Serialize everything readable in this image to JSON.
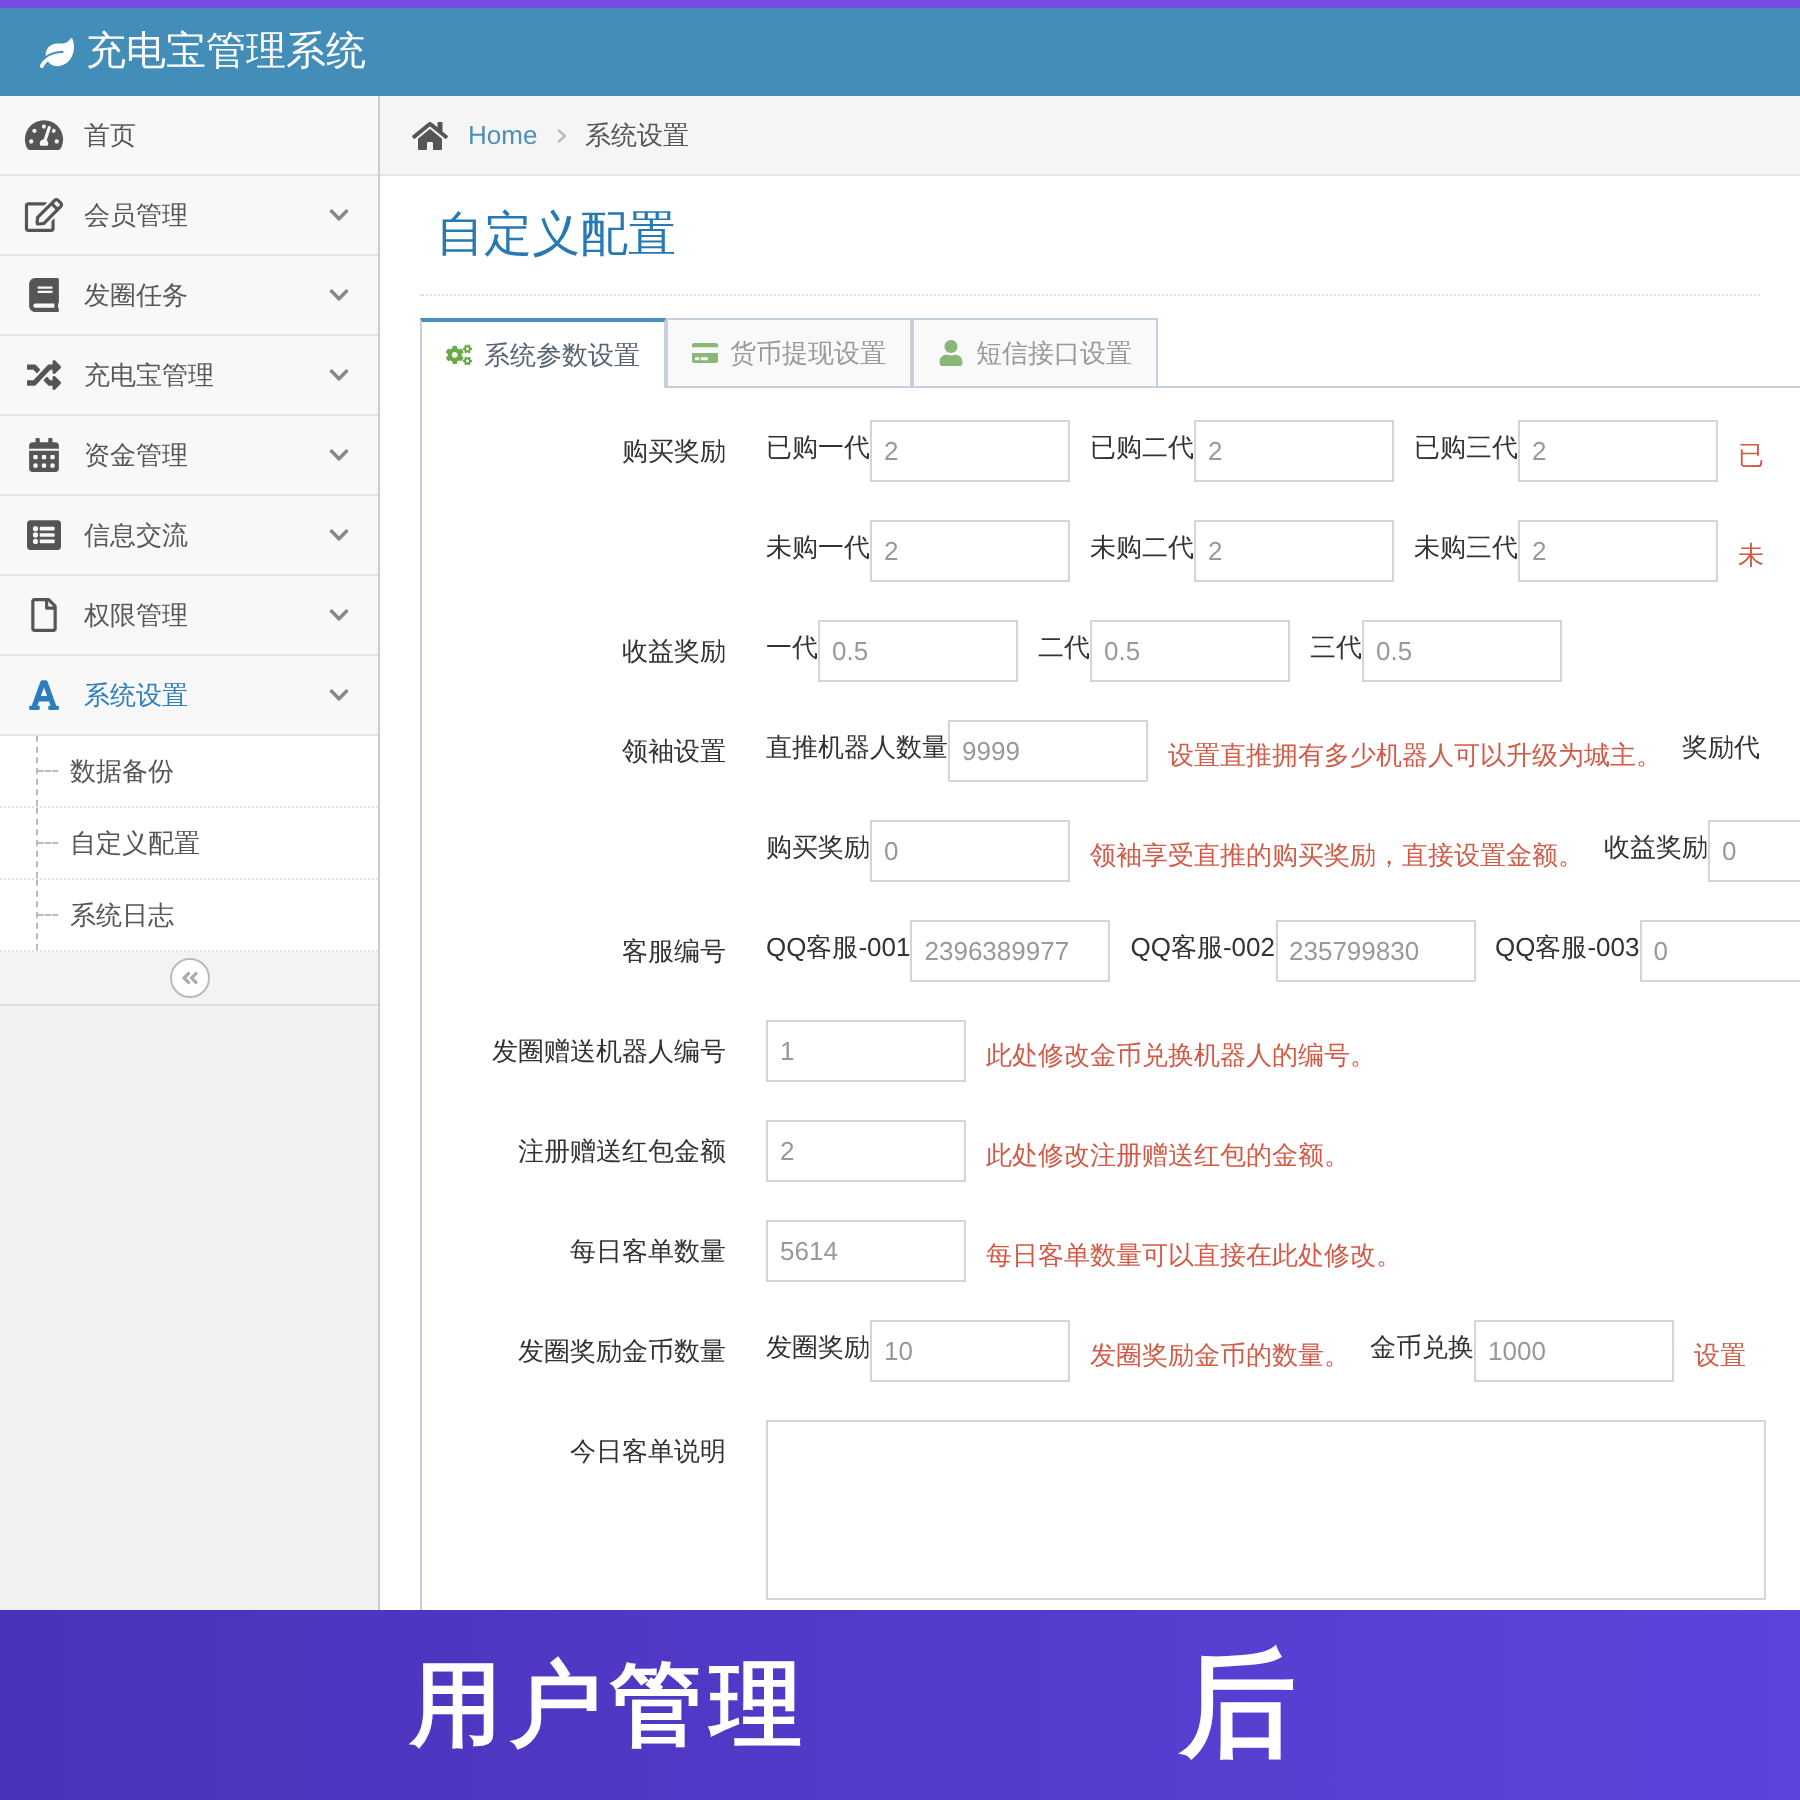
{
  "header": {
    "title": "充电宝管理系统"
  },
  "sidebar": {
    "items": [
      {
        "kind": "link",
        "label": "首页",
        "selected": false
      },
      {
        "kind": "menu",
        "label": "会员管理",
        "selected": false
      },
      {
        "kind": "menu",
        "label": "发圈任务",
        "selected": false
      },
      {
        "kind": "menu",
        "label": "充电宝管理",
        "selected": false
      },
      {
        "kind": "menu",
        "label": "资金管理",
        "selected": false
      },
      {
        "kind": "menu",
        "label": "信息交流",
        "selected": false
      },
      {
        "kind": "menu",
        "label": "权限管理",
        "selected": false
      },
      {
        "kind": "menu",
        "label": "系统设置",
        "selected": true,
        "children": [
          {
            "label": "数据备份"
          },
          {
            "label": "自定义配置"
          },
          {
            "label": "系统日志"
          }
        ]
      }
    ]
  },
  "breadcrumb": {
    "home": "Home",
    "current": "系统设置"
  },
  "page_title": "自定义配置",
  "tabs": [
    {
      "label": "系统参数设置",
      "selected": true
    },
    {
      "label": "货币提现设置",
      "selected": false
    },
    {
      "label": "短信接口设置",
      "selected": false
    }
  ],
  "form_rows": [
    {
      "label": "购买奖励",
      "items": [
        {
          "kind": "label",
          "text": "已购一代"
        },
        {
          "kind": "input",
          "value": "2"
        },
        {
          "kind": "label",
          "text": "已购二代"
        },
        {
          "kind": "input",
          "value": "2"
        },
        {
          "kind": "label",
          "text": "已购三代"
        },
        {
          "kind": "input",
          "value": "2"
        },
        {
          "kind": "note",
          "text": "已"
        }
      ]
    },
    {
      "items": [
        {
          "kind": "label",
          "text": "未购一代"
        },
        {
          "kind": "input",
          "value": "2"
        },
        {
          "kind": "label",
          "text": "未购二代"
        },
        {
          "kind": "input",
          "value": "2"
        },
        {
          "kind": "label",
          "text": "未购三代"
        },
        {
          "kind": "input",
          "value": "2"
        },
        {
          "kind": "note",
          "text": "未"
        }
      ]
    },
    {
      "label": "收益奖励",
      "items": [
        {
          "kind": "label",
          "text": "一代"
        },
        {
          "kind": "input",
          "value": "0.5"
        },
        {
          "kind": "label",
          "text": "二代"
        },
        {
          "kind": "input",
          "value": "0.5"
        },
        {
          "kind": "label",
          "text": "三代"
        },
        {
          "kind": "input",
          "value": "0.5"
        }
      ]
    },
    {
      "label": "领袖设置",
      "items": [
        {
          "kind": "label",
          "text": "直推机器人数量"
        },
        {
          "kind": "input",
          "value": "9999"
        },
        {
          "kind": "note",
          "text": "设置直推拥有多少机器人可以升级为城主。"
        },
        {
          "kind": "label",
          "text": "奖励代"
        }
      ]
    },
    {
      "items": [
        {
          "kind": "label",
          "text": "购买奖励"
        },
        {
          "kind": "input",
          "value": "0"
        },
        {
          "kind": "note",
          "text": "领袖享受直推的购买奖励，直接设置金额。"
        },
        {
          "kind": "label",
          "text": "收益奖励"
        },
        {
          "kind": "input",
          "value": "0"
        }
      ]
    },
    {
      "label": "客服编号",
      "items": [
        {
          "kind": "label",
          "text": "QQ客服-001"
        },
        {
          "kind": "input",
          "value": "2396389977"
        },
        {
          "kind": "label",
          "text": "QQ客服-002"
        },
        {
          "kind": "input",
          "value": "235799830"
        },
        {
          "kind": "label",
          "text": "QQ客服-003"
        },
        {
          "kind": "input",
          "value": "0"
        }
      ]
    },
    {
      "label": "发圈赠送机器人编号",
      "items": [
        {
          "kind": "input",
          "value": "1"
        },
        {
          "kind": "note",
          "text": "此处修改金币兑换机器人的编号。"
        }
      ]
    },
    {
      "label": "注册赠送红包金额",
      "items": [
        {
          "kind": "input",
          "value": "2"
        },
        {
          "kind": "note",
          "text": "此处修改注册赠送红包的金额。"
        }
      ]
    },
    {
      "label": "每日客单数量",
      "items": [
        {
          "kind": "input",
          "value": "5614"
        },
        {
          "kind": "note",
          "text": "每日客单数量可以直接在此处修改。"
        }
      ]
    },
    {
      "label": "发圈奖励金币数量",
      "items": [
        {
          "kind": "label",
          "text": "发圈奖励"
        },
        {
          "kind": "input",
          "value": "10"
        },
        {
          "kind": "note",
          "text": "发圈奖励金币的数量。"
        },
        {
          "kind": "label",
          "text": "金币兑换"
        },
        {
          "kind": "input",
          "value": "1000"
        },
        {
          "kind": "note",
          "text": "设置"
        }
      ]
    },
    {
      "label": "今日客单说明",
      "items": [
        {
          "kind": "textarea"
        }
      ]
    }
  ],
  "banner": {
    "left": "用户管理",
    "right": "后"
  }
}
